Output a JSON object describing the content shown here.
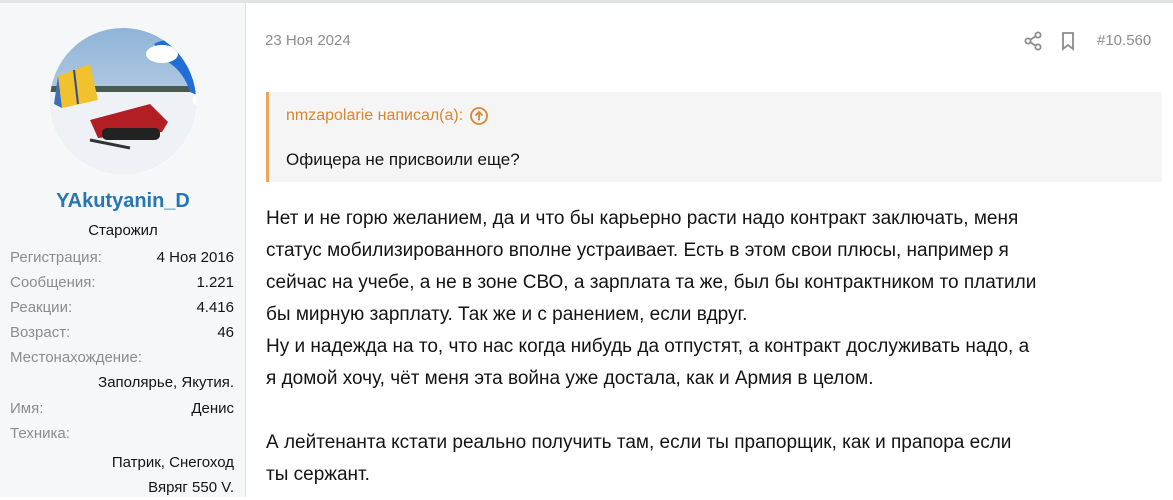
{
  "author": {
    "username": "YAkutyanin_D",
    "title": "Старожил",
    "stats": [
      {
        "key": "Регистрация:",
        "value": "4 Ноя 2016"
      },
      {
        "key": "Сообщения:",
        "value": "1.221"
      },
      {
        "key": "Реакции:",
        "value": "4.416"
      },
      {
        "key": "Возраст:",
        "value": "46"
      },
      {
        "key": "Местонахождение:",
        "value": "Заполярье, Якутия."
      },
      {
        "key": "Имя:",
        "value": "Денис"
      },
      {
        "key": "Техника:",
        "value": "Патрик, Снегоход Вяряг 550 V."
      }
    ]
  },
  "post": {
    "date": "23 Ноя 2024",
    "number": "#10.560",
    "quote": {
      "author_label": "nmzapolarie написал(а):",
      "text": "Офицера не присвоили еще?"
    },
    "lines": [
      "Нет и не горю желанием, да и что бы карьерно расти надо контракт заключать, меня",
      "статус мобилизированного вполне устраивает. Есть в этом свои плюсы, например я",
      "сейчас на учебе, а не в зоне СВО, а зарплата та же, был бы контрактником то платили",
      "бы мирную зарплату. Так же и с ранением, если вдруг.",
      "Ну и надежда на то, что нас когда нибудь да отпустят, а контракт дослуживать надо, а",
      "я домой хочу, чёт меня эта война уже достала, как и Армия в целом.",
      "",
      "А лейтенанта кстати реально получить там, если ты прапорщик, как и прапора если",
      "ты сержант."
    ]
  },
  "icons": {
    "share": "share-icon",
    "bookmark": "bookmark-icon",
    "quote_jump": "arrow-up-circle-icon"
  },
  "colors": {
    "username": "#2577b1",
    "quote_border": "#f0a35a",
    "quote_author": "#d9862f",
    "muted": "#8c8c8c",
    "sidebar_bg": "#f5f7f9"
  }
}
